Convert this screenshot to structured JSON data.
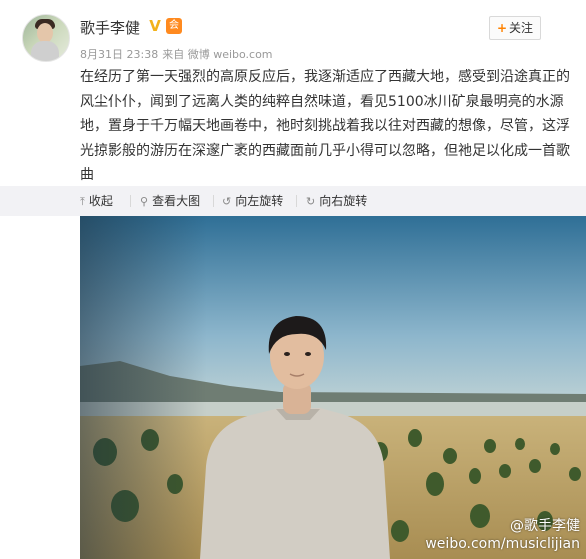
{
  "header": {
    "user_name": "歌手李健",
    "verified_mark": "V",
    "vip_mark": "会",
    "date": "8月31日 23:38",
    "source": "来自 微博 weibo.com",
    "follow_label": "关注",
    "follow_plus": "+"
  },
  "post": {
    "text": "在经历了第一天强烈的高原反应后，我逐渐适应了西藏大地，感受到沿途真正的风尘仆仆，闻到了远离人类的纯粹自然味道，看见5100冰川矿泉最明亮的水源地，置身于千万幅天地画卷中，祂时刻挑战着我以往对西藏的想像，尽管，这浮光掠影般的游历在深邃广袤的西藏面前几乎小得可以忽略，但祂足以化成一首歌曲"
  },
  "toolbar": {
    "collapse_label": "收起",
    "view_large_label": "查看大图",
    "rotate_left_label": "向左旋转",
    "rotate_right_label": "向右旋转"
  },
  "photo": {
    "watermark_name": "@歌手李健",
    "watermark_url": "weibo.com/musiclijian"
  },
  "colors": {
    "accent": "#ff8200",
    "toolbar_bg": "#f2f2f5",
    "verified": "#f2b21a"
  }
}
